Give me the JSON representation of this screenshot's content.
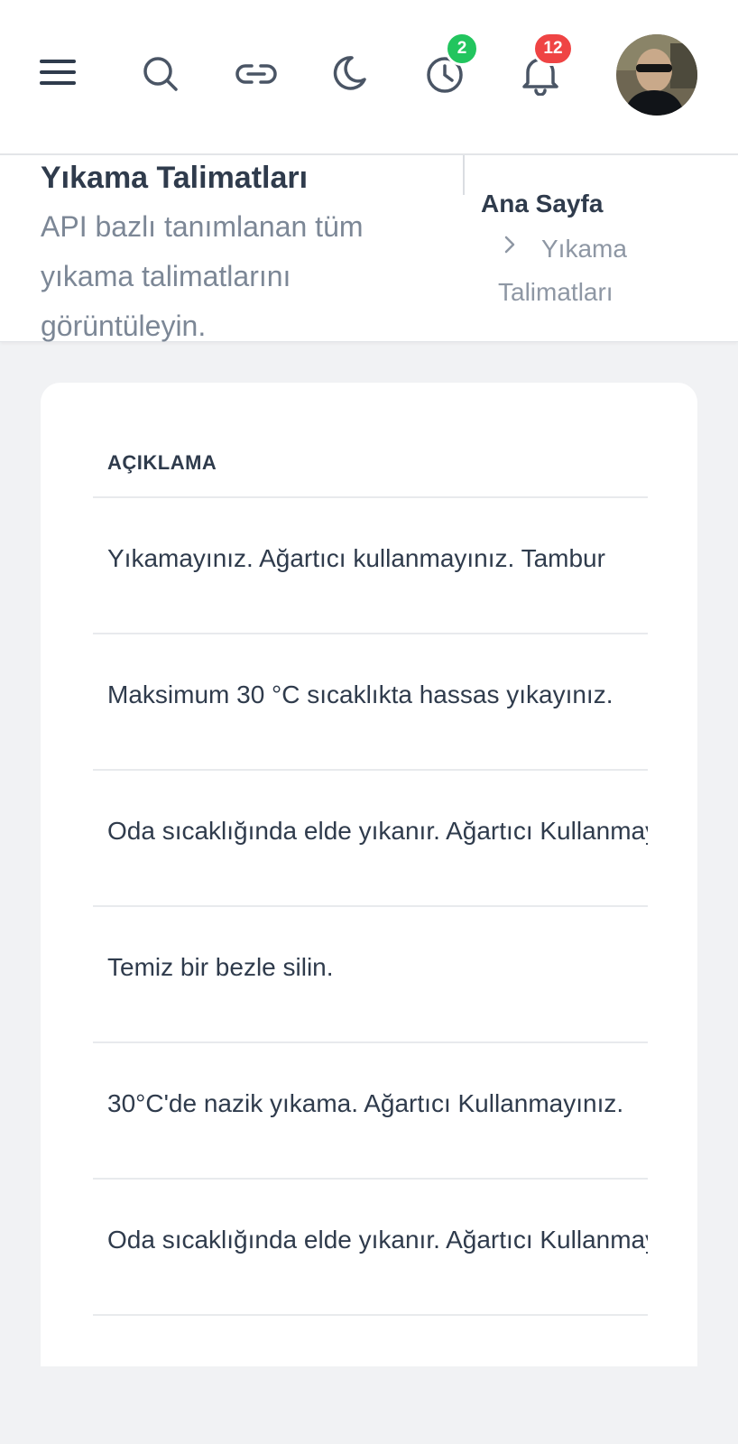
{
  "topbar": {
    "menu_icon": "hamburger-menu-icon",
    "search_icon": "search-icon",
    "link_icon": "link-icon",
    "theme_icon": "moon-icon",
    "history_icon": "clock-icon",
    "history_badge": "2",
    "notifications_icon": "bell-icon",
    "notifications_badge": "12",
    "colors": {
      "history_badge": "#22c55e",
      "notifications_badge": "#ef4444"
    }
  },
  "page_header": {
    "title": "Yıkama Talimatları",
    "subtitle": "API bazlı tanımlanan tüm yıkama talimatlarını görüntüleyin.",
    "breadcrumb": {
      "home": "Ana Sayfa",
      "current": "Yıkama Talimatları"
    }
  },
  "table": {
    "header": "AÇIKLAMA",
    "rows": [
      "Yıkamayınız. Ağartıcı kullanmayınız. Tambur",
      "Maksimum 30 °C sıcaklıkta hassas yıkayınız.",
      "Oda sıcaklığında elde yıkanır. Ağartıcı Kullanmayınız.",
      "Temiz bir bezle silin.",
      "30°C'de nazik yıkama. Ağartıcı Kullanmayınız.",
      "Oda sıcaklığında elde yıkanır. Ağartıcı Kullanmayınız."
    ]
  }
}
